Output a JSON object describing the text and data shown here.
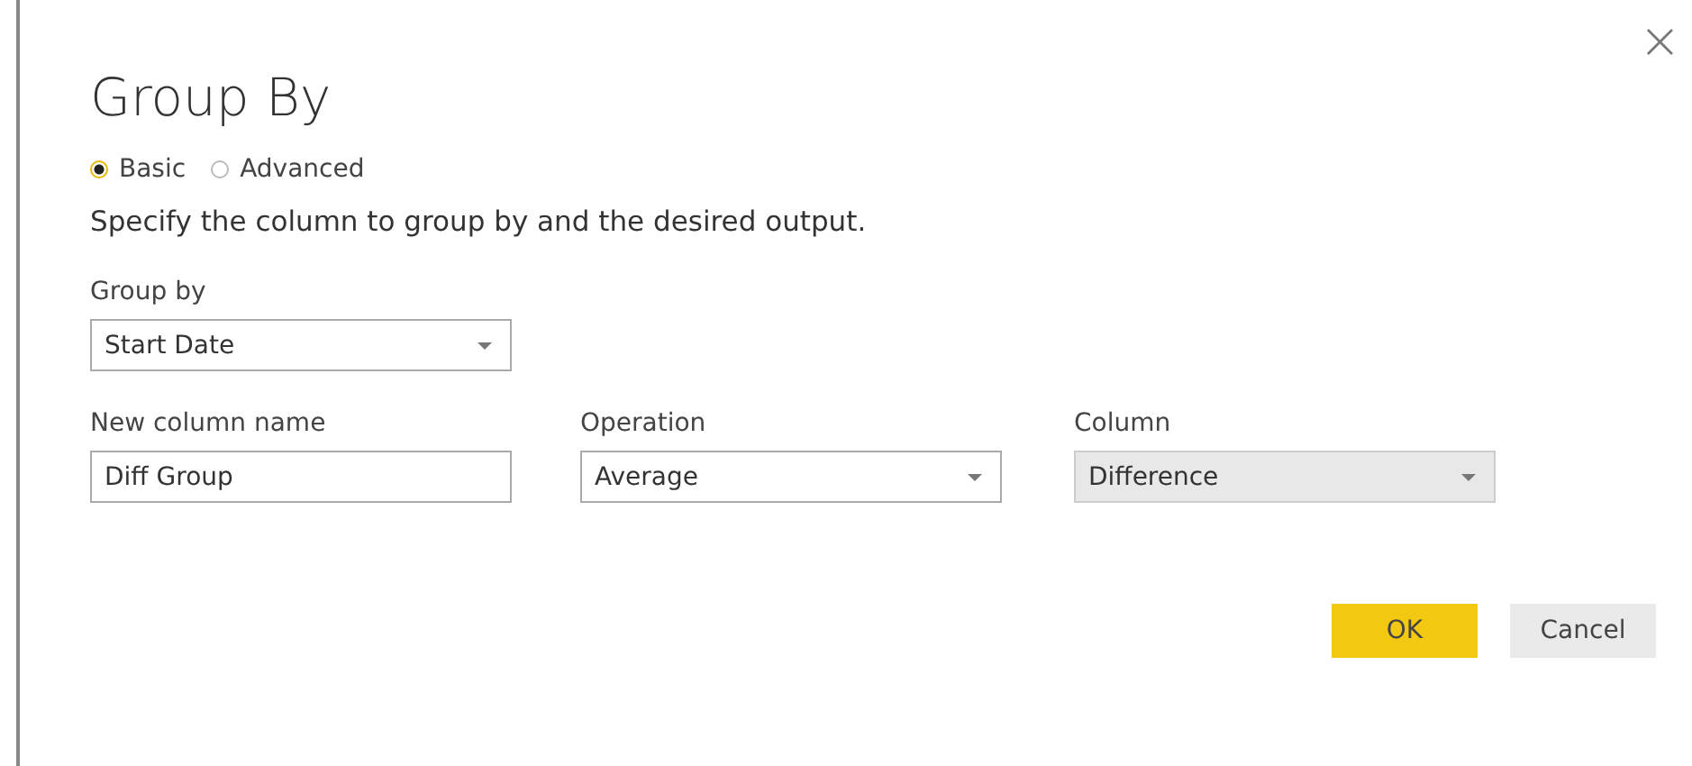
{
  "dialog": {
    "title": "Group By",
    "close": "×"
  },
  "modes": [
    {
      "label": "Basic",
      "selected": true
    },
    {
      "label": "Advanced",
      "selected": false
    }
  ],
  "description": "Specify the column to group by and the desired output.",
  "group_by": {
    "label": "Group by",
    "value": "Start Date"
  },
  "aggregations": [
    {
      "kind": "text",
      "label": "New column name",
      "value": "Diff Group",
      "disabled": false
    },
    {
      "kind": "dropdown",
      "label": "Operation",
      "value": "Average",
      "disabled": false
    },
    {
      "kind": "dropdown",
      "label": "Column",
      "value": "Difference",
      "disabled": true
    }
  ],
  "buttons": [
    {
      "label": "OK",
      "kind": "primary"
    },
    {
      "label": "Cancel",
      "kind": "secondary"
    }
  ]
}
